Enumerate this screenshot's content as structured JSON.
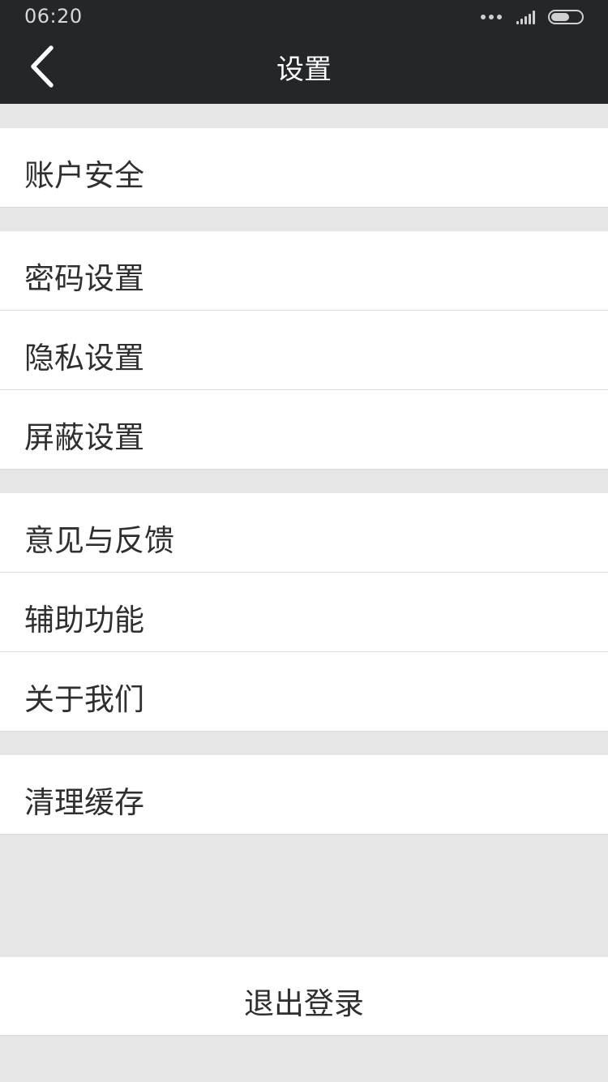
{
  "status_bar": {
    "time": "06:20",
    "battery_level": 0.6
  },
  "title_bar": {
    "title": "设置",
    "back_icon": "chevron-left-icon"
  },
  "groups": [
    {
      "items": [
        {
          "label": "账户安全"
        }
      ]
    },
    {
      "items": [
        {
          "label": "密码设置"
        },
        {
          "label": "隐私设置"
        },
        {
          "label": "屏蔽设置"
        }
      ]
    },
    {
      "items": [
        {
          "label": "意见与反馈"
        },
        {
          "label": "辅助功能"
        },
        {
          "label": "关于我们"
        }
      ]
    },
    {
      "items": [
        {
          "label": "清理缓存"
        }
      ]
    }
  ],
  "logout": {
    "label": "退出登录"
  },
  "colors": {
    "header_bg": "#25262a",
    "page_bg": "#e6e6e6",
    "row_bg": "#ffffff",
    "text": "#2f2f2f"
  }
}
